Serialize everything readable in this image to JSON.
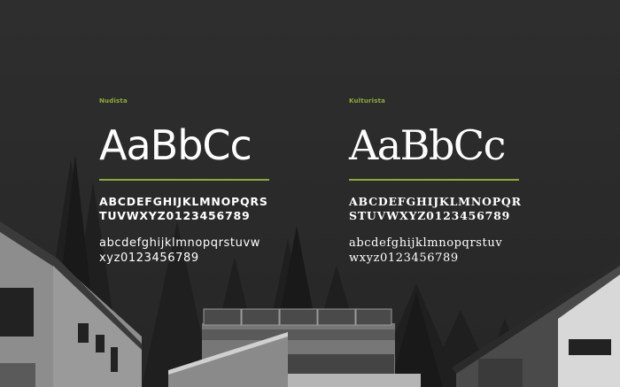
{
  "accent_color": "#8faa3c",
  "fonts": [
    {
      "name": "Nudista",
      "specimen": "AaBbCc",
      "uppercase_line1": "ABCDEFGHIJKLMNOPQRS",
      "uppercase_line2": "TUVWXYZ0123456789",
      "lowercase_line1": "abcdefghijklmnopqrstuvw",
      "lowercase_line2": "xyz0123456789"
    },
    {
      "name": "Kulturista",
      "specimen": "AaBbCc",
      "uppercase_line1": "ABCDEFGHIJKLMNOPQR",
      "uppercase_line2": "STUVWXYZ0123456789",
      "lowercase_line1": "abcdefghijklmnopqrstuv",
      "lowercase_line2": "wxyz0123456789"
    }
  ],
  "background": {
    "icons": [
      "pine-tree-icon",
      "house-icon",
      "solar-panel-icon"
    ]
  }
}
